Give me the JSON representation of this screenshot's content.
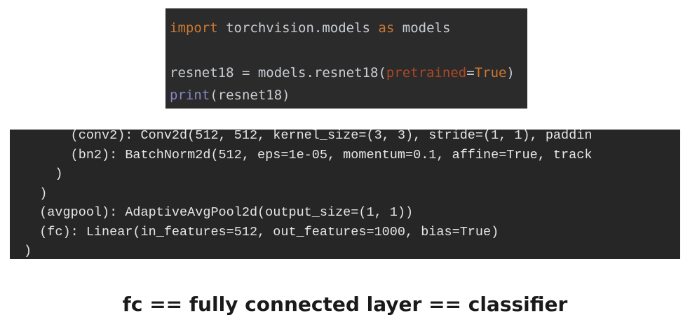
{
  "code_editor": {
    "line1": {
      "kw_import": "import",
      "module": " torchvision.models ",
      "kw_as": "as",
      "alias": " models"
    },
    "line2": "",
    "line3": {
      "assign": "resnet18 = models.resnet18(",
      "param": "pretrained",
      "equals": "=",
      "value": "True",
      "close": ")"
    },
    "line4": {
      "builtin": "print",
      "args": "(resnet18)"
    },
    "colors": {
      "background": "#2b2b2b",
      "keyword": "#cc7832",
      "param": "#aa4926",
      "builtin": "#8888c6",
      "text": "#c9cdd2"
    }
  },
  "terminal_output": {
    "lines": [
      "      (conv2): Conv2d(512, 512, kernel_size=(3, 3), stride=(1, 1), paddin",
      "      (bn2): BatchNorm2d(512, eps=1e-05, momentum=0.1, affine=True, track",
      "    )",
      "  )",
      "  (avgpool): AdaptiveAvgPool2d(output_size=(1, 1))",
      "  (fc): Linear(in_features=512, out_features=1000, bias=True)",
      ")"
    ],
    "background": "#262626"
  },
  "caption": "fc == fully connected layer == classifier"
}
